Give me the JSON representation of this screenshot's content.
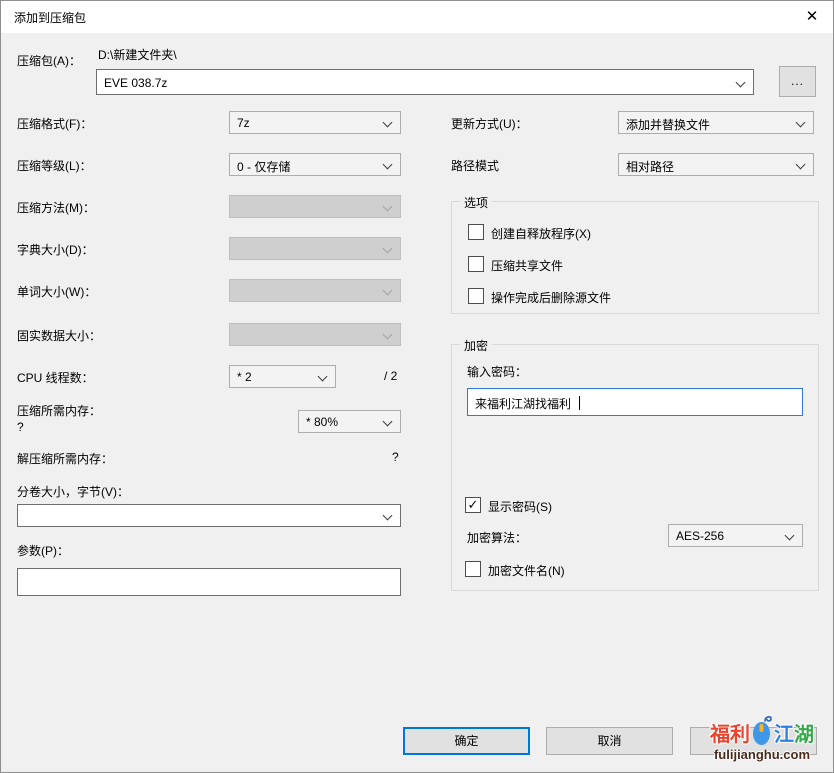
{
  "window": {
    "title": "添加到压缩包",
    "close_glyph": "✕"
  },
  "archive": {
    "label": "压缩包(A)：",
    "dir_path": "D:\\新建文件夹\\",
    "name_value": "EVE 038.7z",
    "browse_label": "..."
  },
  "left": {
    "format": {
      "label": "压缩格式(F)：",
      "value": "7z"
    },
    "level": {
      "label": "压缩等级(L)：",
      "value": "0 - 仅存储"
    },
    "method": {
      "label": "压缩方法(M)：",
      "value": ""
    },
    "dict": {
      "label": "字典大小(D)：",
      "value": ""
    },
    "word": {
      "label": "单词大小(W)：",
      "value": ""
    },
    "solid": {
      "label": "固实数据大小：",
      "value": ""
    },
    "cpu": {
      "label": "CPU 线程数：",
      "value": "* 2",
      "suffix": "/ 2"
    },
    "mem_compress": {
      "label": "压缩所需内存：",
      "note": "?",
      "value": "* 80%"
    },
    "mem_decompress": {
      "label": "解压缩所需内存：",
      "value": "?"
    },
    "volume": {
      "label": "分卷大小，字节(V)：",
      "value": ""
    },
    "params": {
      "label": "参数(P)：",
      "value": ""
    }
  },
  "right": {
    "update_mode": {
      "label": "更新方式(U)：",
      "value": "添加并替换文件"
    },
    "path_mode": {
      "label": "路径模式",
      "value": "相对路径"
    },
    "options_group": {
      "title": "选项",
      "checkboxes": [
        {
          "label": "创建自释放程序(X)",
          "checked": false,
          "glyph": ""
        },
        {
          "label": "压缩共享文件",
          "checked": false,
          "glyph": ""
        },
        {
          "label": "操作完成后删除源文件",
          "checked": false,
          "glyph": ""
        }
      ]
    },
    "encryption_group": {
      "title": "加密",
      "password_label": "输入密码：",
      "password_value": "来福利江湖找福利",
      "show_password": {
        "label": "显示密码(S)",
        "checked": true,
        "glyph": "✓"
      },
      "algorithm": {
        "label": "加密算法：",
        "value": "AES-256"
      },
      "encrypt_names": {
        "label": "加密文件名(N)",
        "checked": false,
        "glyph": ""
      }
    }
  },
  "footer": {
    "ok_label": "确定",
    "cancel_label": "取消",
    "help_label": ""
  },
  "watermark": {
    "char1": "福",
    "char2": "利",
    "char3": "江",
    "char4": "湖",
    "url": "fulijianghu.com",
    "colors": {
      "red": "#e8442e",
      "blue": "#2f7fe0",
      "green": "#35a94c",
      "mouse_body": "#3f97e8",
      "mouse_wheel": "#f6b32b"
    }
  },
  "colors": {
    "accent_focus_blue": "#0078d7",
    "titlebar_bg": "#ffffff",
    "body_bg": "#f0f0f0"
  }
}
